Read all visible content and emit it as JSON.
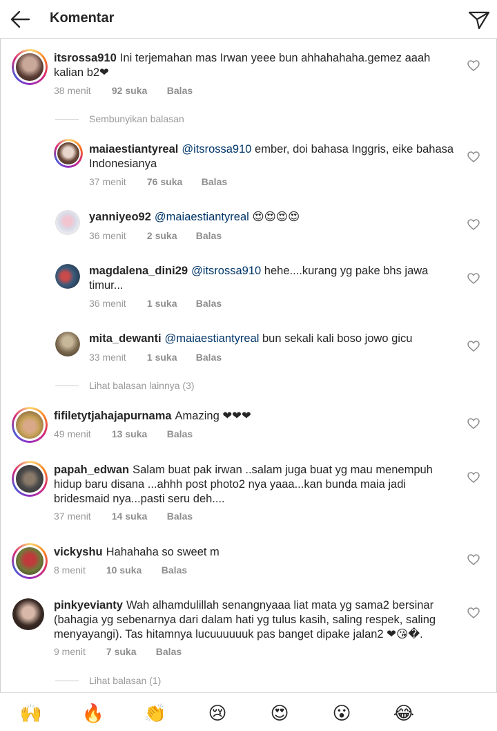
{
  "header": {
    "title": "Komentar"
  },
  "comments": [
    {
      "user": "itsrossa910",
      "text_pre": "",
      "mention": "",
      "text": "Ini terjemahan mas Irwan yeee bun ahhahahaha.gemez aaah kalian b2❤",
      "time": "38 menit",
      "likes": "92 suka",
      "reply": "Balas"
    },
    {
      "user": "maiaestiantyreal",
      "mention": "@itsrossa910",
      "text": " ember, doi bahasa Inggris, eike bahasa Indonesianya",
      "time": "37 menit",
      "likes": "76 suka",
      "reply": "Balas"
    },
    {
      "user": "yanniyeo92",
      "mention": "@maiaestiantyreal",
      "text": " 😍😍😍😍",
      "time": "36 menit",
      "likes": "2 suka",
      "reply": "Balas"
    },
    {
      "user": "magdalena_dini29",
      "mention": "@itsrossa910",
      "text": " hehe....kurang yg pake bhs jawa timur...",
      "time": "36 menit",
      "likes": "1 suka",
      "reply": "Balas"
    },
    {
      "user": "mita_dewanti",
      "mention": "@maiaestiantyreal",
      "text": " bun sekali kali boso jowo gicu",
      "time": "33 menit",
      "likes": "1 suka",
      "reply": "Balas"
    },
    {
      "user": "fifiletytjahajapurnama",
      "mention": "",
      "text": "Amazing ❤❤❤",
      "time": "49 menit",
      "likes": "13 suka",
      "reply": "Balas"
    },
    {
      "user": "papah_edwan",
      "mention": "",
      "text": "Salam buat pak irwan ..salam juga buat yg mau menempuh hidup baru disana ...ahhh post photo2 nya yaaa...kan bunda maia jadi bridesmaid nya...pasti seru deh....",
      "time": "37 menit",
      "likes": "14 suka",
      "reply": "Balas"
    },
    {
      "user": "vickyshu",
      "mention": "",
      "text": "Hahahaha so sweet m",
      "time": "8 menit",
      "likes": "10 suka",
      "reply": "Balas"
    },
    {
      "user": "pinkyevianty",
      "mention": "",
      "text": "Wah alhamdulillah senangnyaaa liat mata yg sama2 bersinar (bahagia yg sebenarnya dari dalam hati yg tulus kasih, saling respek, saling menyayangi). Tas hitamnya lucuuuuuuk pas banget dipake jalan2 ❤😘�.",
      "time": "9 menit",
      "likes": "7 suka",
      "reply": "Balas"
    }
  ],
  "threads": {
    "hide_replies": "Sembunyikan balasan",
    "more_replies": "Lihat balasan lainnya (3)",
    "view_replies": "Lihat balasan (1)"
  },
  "emoji_bar": [
    "🙌",
    "🔥",
    "👏",
    "😢",
    "😍",
    "😮",
    "😂"
  ],
  "colors": {
    "mention": "#003569",
    "meta": "#999999",
    "text": "#262626"
  }
}
